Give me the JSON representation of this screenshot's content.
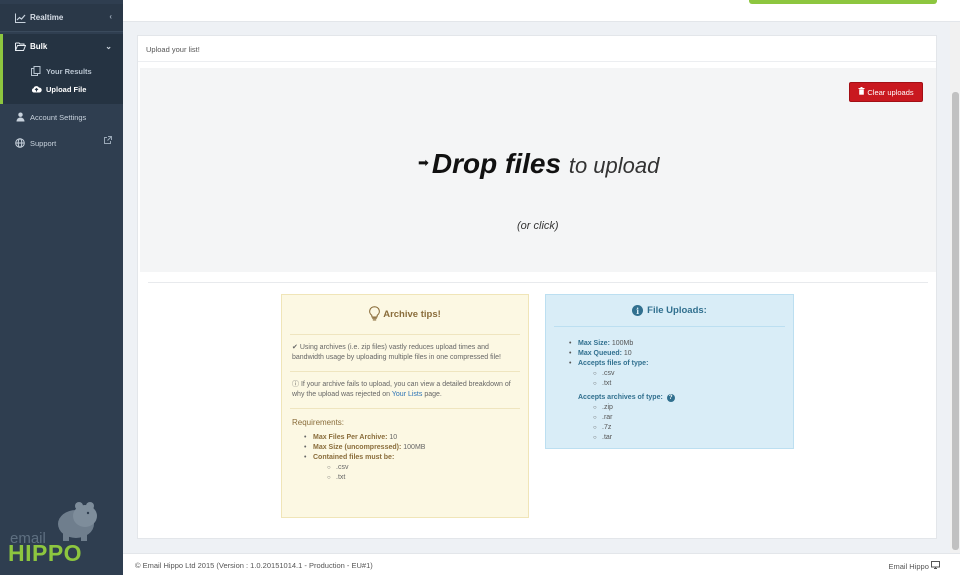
{
  "sidebar": {
    "items": [
      {
        "label": "Realtime",
        "icon": "chart-line-icon"
      },
      {
        "label": "Bulk",
        "icon": "folder-open-icon"
      },
      {
        "label": "Account Settings",
        "icon": "user-icon"
      },
      {
        "label": "Support",
        "icon": "globe-icon"
      }
    ],
    "subitems": [
      {
        "label": "Your Results",
        "icon": "copy-icon"
      },
      {
        "label": "Upload File",
        "icon": "cloud-upload-icon"
      }
    ],
    "logo": {
      "word1": "email",
      "word2": "HIPPO"
    }
  },
  "panel": {
    "title": "Upload your list!",
    "clear_button": "Clear uploads",
    "drop_bold": "Drop files",
    "drop_light": "to upload",
    "or_click": "(or click)"
  },
  "tips": {
    "title": "Archive tips!",
    "tip1": "Using archives (i.e. zip files) vastly reduces upload times and bandwidth usage by uploading multiple files in one compressed file!",
    "tip2_prefix": "If your archive fails to upload, you can view a detailed breakdown of why the upload was rejected on",
    "tip2_link": "Your Lists",
    "tip2_suffix": "page.",
    "requirements_title": "Requirements:",
    "req": [
      {
        "label": "Max Files Per Archive:",
        "value": "10"
      },
      {
        "label": "Max Size (uncompressed):",
        "value": "100MB"
      },
      {
        "label": "Contained files must be:",
        "value": ""
      }
    ],
    "file_types": [
      ".csv",
      ".txt"
    ]
  },
  "uploads": {
    "title": "File Uploads:",
    "max_size_label": "Max Size:",
    "max_size_value": "100Mb",
    "max_queued_label": "Max Queued:",
    "max_queued_value": "10",
    "accepts_files_label": "Accepts files of type:",
    "file_types": [
      ".csv",
      ".txt"
    ],
    "accepts_archives_label": "Accepts archives of type:",
    "archive_types": [
      ".zip",
      ".rar",
      ".7z",
      ".tar"
    ]
  },
  "footer": {
    "copyright": "© Email Hippo Ltd 2015 (Version : 1.0.20151014.1 - Production - EU#1)",
    "brand": "Email Hippo"
  },
  "colors": {
    "sidebar_bg": "#2f3e50",
    "accent_green": "#8dc63f",
    "danger_red": "#c9181f",
    "warning_bg": "#fcf8e3",
    "info_bg": "#d9edf7"
  }
}
